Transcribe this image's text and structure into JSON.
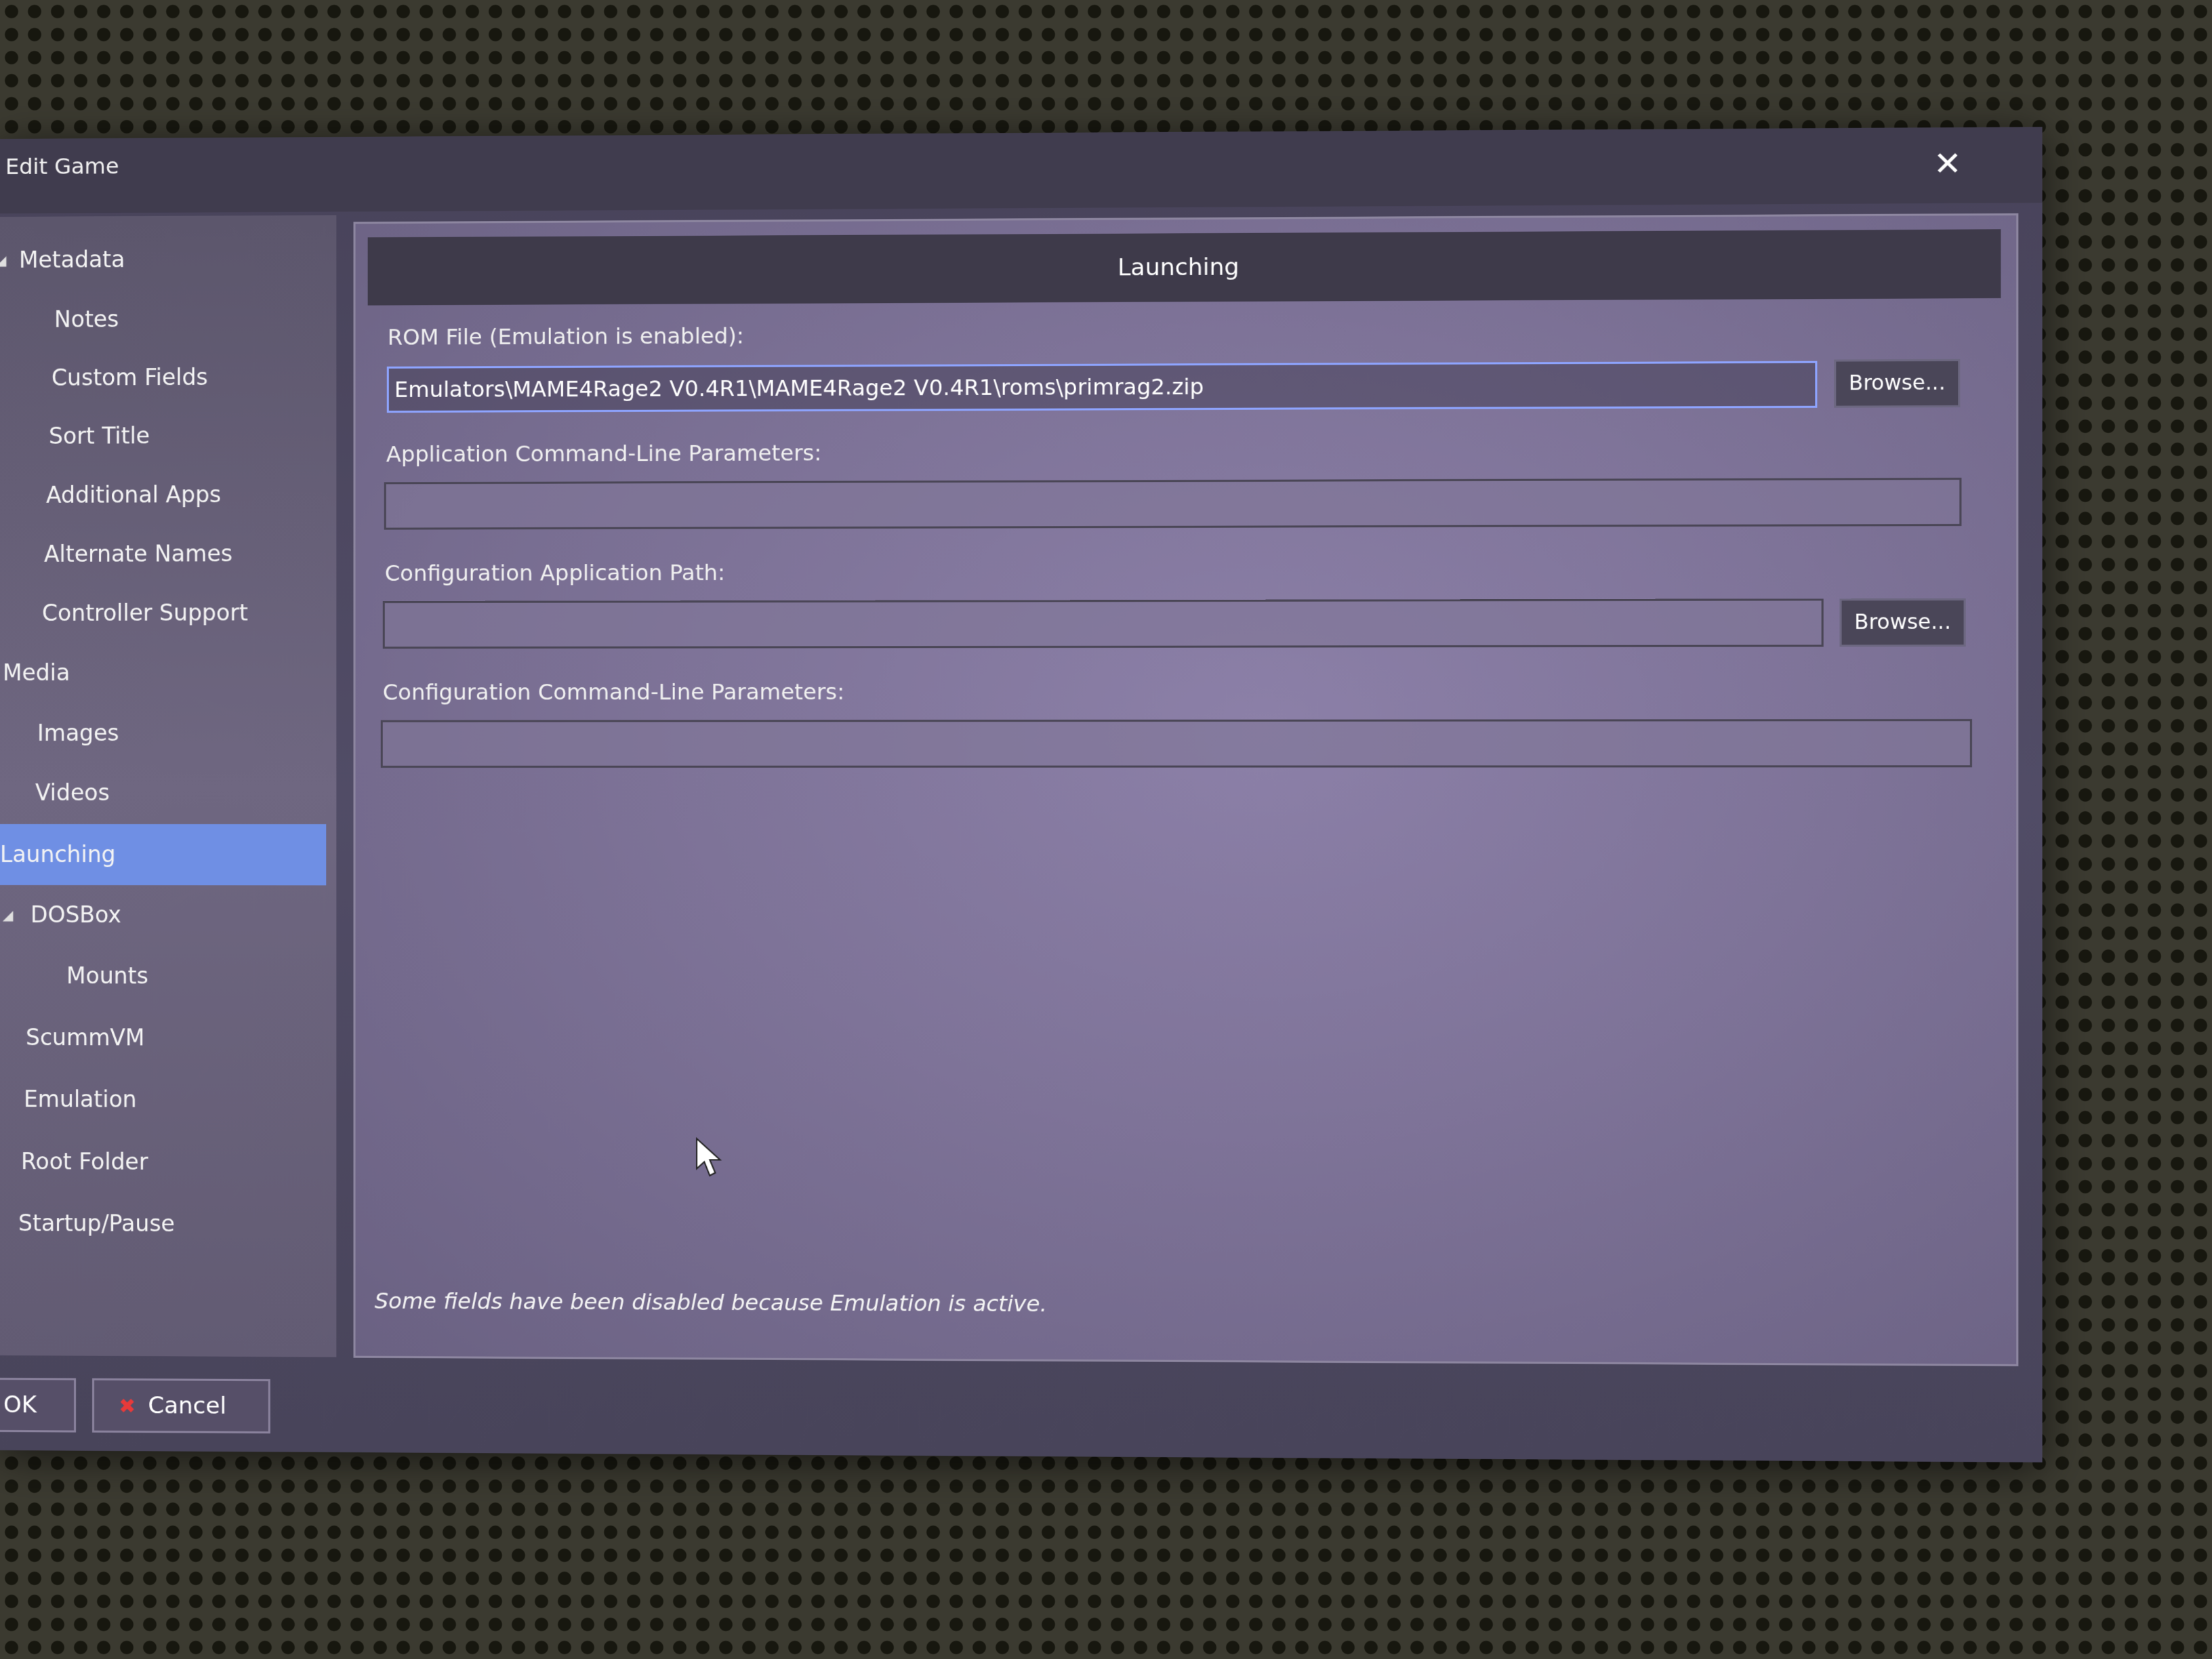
{
  "window": {
    "title": "Edit Game",
    "close_icon": "close-icon"
  },
  "sidebar": {
    "items": [
      {
        "label": "Metadata"
      },
      {
        "label": "Notes"
      },
      {
        "label": "Custom Fields"
      },
      {
        "label": "Sort Title"
      },
      {
        "label": "Additional Apps"
      },
      {
        "label": "Alternate Names"
      },
      {
        "label": "Controller Support"
      },
      {
        "label": "Media"
      },
      {
        "label": "Images"
      },
      {
        "label": "Videos"
      },
      {
        "label": "Launching"
      },
      {
        "label": "DOSBox"
      },
      {
        "label": "Mounts"
      },
      {
        "label": "ScummVM"
      },
      {
        "label": "Emulation"
      },
      {
        "label": "Root Folder"
      },
      {
        "label": "Startup/Pause"
      }
    ],
    "selected": "Launching"
  },
  "main": {
    "header": "Launching",
    "rom_file": {
      "label": "ROM File (Emulation is enabled):",
      "value": "Emulators\\MAME4Rage2 V0.4R1\\MAME4Rage2 V0.4R1\\roms\\primrag2.zip",
      "browse_label": "Browse..."
    },
    "app_params": {
      "label": "Application Command-Line Parameters:",
      "value": ""
    },
    "config_path": {
      "label": "Configuration Application Path:",
      "value": "",
      "browse_label": "Browse..."
    },
    "config_params": {
      "label": "Configuration Command-Line Parameters:",
      "value": ""
    },
    "note": "Some fields have been disabled because Emulation is active."
  },
  "footer": {
    "ok_label": "OK",
    "cancel_label": "Cancel",
    "cancel_icon": "red-x-icon"
  },
  "colors": {
    "selected_item": "#6f8fe4",
    "focus_border": "#8ea4ff",
    "cancel_icon": "#e83a3a"
  }
}
